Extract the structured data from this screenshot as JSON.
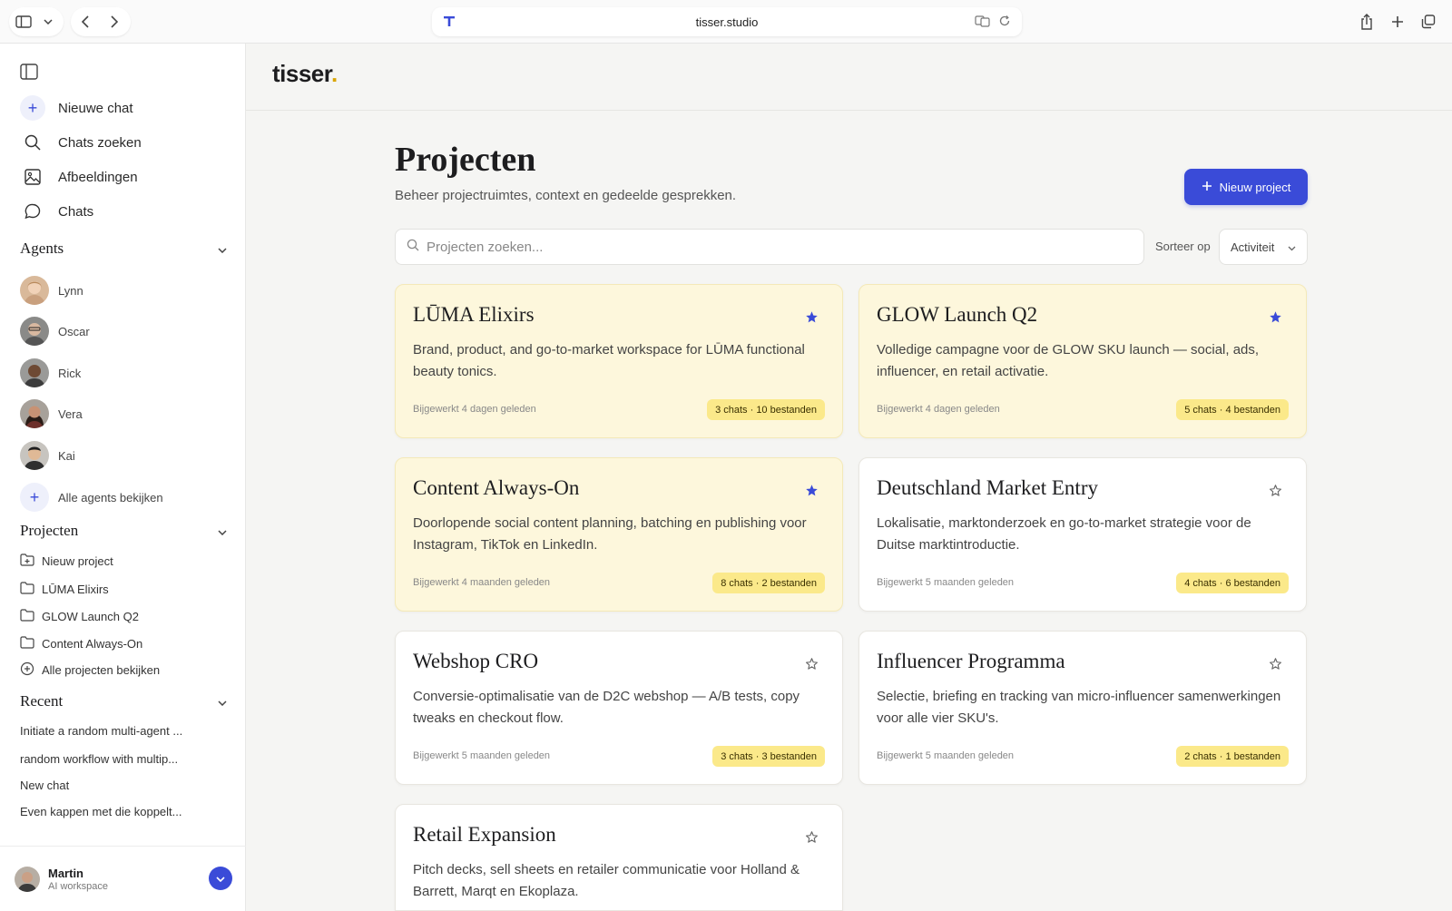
{
  "browser": {
    "url": "tisser.studio"
  },
  "sidebar": {
    "nav": [
      {
        "label": "Nieuwe chat",
        "icon": "plus-icon"
      },
      {
        "label": "Chats zoeken",
        "icon": "search-icon"
      },
      {
        "label": "Afbeeldingen",
        "icon": "image-icon"
      },
      {
        "label": "Chats",
        "icon": "chat-bubble-icon"
      }
    ],
    "agents_heading": "Agents",
    "agents": [
      {
        "name": "Lynn"
      },
      {
        "name": "Oscar"
      },
      {
        "name": "Rick"
      },
      {
        "name": "Vera"
      },
      {
        "name": "Kai"
      }
    ],
    "all_agents": "Alle agents bekijken",
    "projects_heading": "Projecten",
    "projects": [
      {
        "label": "Nieuw project"
      },
      {
        "label": "LŪMA Elixirs"
      },
      {
        "label": "GLOW Launch Q2"
      },
      {
        "label": "Content Always-On"
      },
      {
        "label": "Alle projecten bekijken"
      }
    ],
    "recent_heading": "Recent",
    "recent": [
      "Initiate a random multi-agent ...",
      "random workflow with multip...",
      "New chat",
      "Even kappen met die koppelt..."
    ],
    "user": {
      "name": "Martin",
      "subtitle": "AI workspace"
    }
  },
  "header": {
    "logo": "tisser",
    "logo_dot": "."
  },
  "page": {
    "title": "Projecten",
    "subtitle": "Beheer projectruimtes, context en gedeelde gesprekken.",
    "new_button": "Nieuw project",
    "search_placeholder": "Projecten zoeken...",
    "sort_label": "Sorteer op",
    "sort_value": "Activiteit"
  },
  "projects": [
    {
      "title": "LŪMA Elixirs",
      "description": "Brand, product, and go-to-market workspace for LŪMA functional beauty tonics.",
      "updated": "Bijgewerkt 4 dagen geleden",
      "badge": "3 chats · 10 bestanden",
      "starred": true
    },
    {
      "title": "GLOW Launch Q2",
      "description": "Volledige campagne voor de GLOW SKU launch — social, ads, influencer, en retail activatie.",
      "updated": "Bijgewerkt 4 dagen geleden",
      "badge": "5 chats · 4 bestanden",
      "starred": true
    },
    {
      "title": "Content Always-On",
      "description": "Doorlopende social content planning, batching en publishing voor Instagram, TikTok en LinkedIn.",
      "updated": "Bijgewerkt 4 maanden geleden",
      "badge": "8 chats · 2 bestanden",
      "starred": true
    },
    {
      "title": "Deutschland Market Entry",
      "description": "Lokalisatie, marktonderzoek en go-to-market strategie voor de Duitse marktintroductie.",
      "updated": "Bijgewerkt 5 maanden geleden",
      "badge": "4 chats · 6 bestanden",
      "starred": false
    },
    {
      "title": "Webshop CRO",
      "description": "Conversie-optimalisatie van de D2C webshop — A/B tests, copy tweaks en checkout flow.",
      "updated": "Bijgewerkt 5 maanden geleden",
      "badge": "3 chats · 3 bestanden",
      "starred": false
    },
    {
      "title": "Influencer Programma",
      "description": "Selectie, briefing en tracking van micro-influencer samenwerkingen voor alle vier SKU's.",
      "updated": "Bijgewerkt 5 maanden geleden",
      "badge": "2 chats · 1 bestanden",
      "starred": false
    },
    {
      "title": "Retail Expansion",
      "description": "Pitch decks, sell sheets en retailer communicatie voor Holland & Barrett, Marqt en Ekoplaza.",
      "updated": "",
      "badge": "",
      "starred": false
    }
  ],
  "colors": {
    "accent": "#3a4bd8",
    "starred_card": "#fdf7dc",
    "badge": "#fbe98a"
  }
}
